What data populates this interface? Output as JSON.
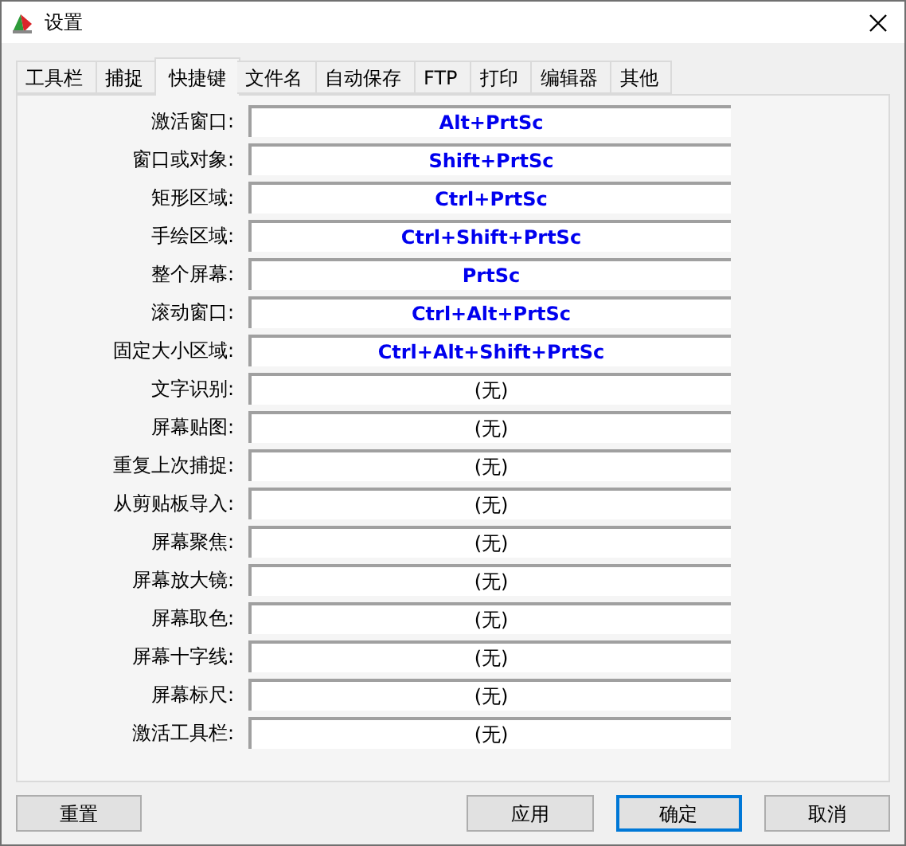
{
  "window": {
    "title": "设置"
  },
  "tabs": [
    {
      "label": "工具栏",
      "selected": false
    },
    {
      "label": "捕捉",
      "selected": false
    },
    {
      "label": "快捷键",
      "selected": true
    },
    {
      "label": "文件名",
      "selected": false
    },
    {
      "label": "自动保存",
      "selected": false
    },
    {
      "label": "FTP",
      "selected": false
    },
    {
      "label": "打印",
      "selected": false
    },
    {
      "label": "编辑器",
      "selected": false
    },
    {
      "label": "其他",
      "selected": false
    }
  ],
  "hotkeys": [
    {
      "label": "激活窗口:",
      "value": "Alt+PrtSc",
      "assigned": true
    },
    {
      "label": "窗口或对象:",
      "value": "Shift+PrtSc",
      "assigned": true
    },
    {
      "label": "矩形区域:",
      "value": "Ctrl+PrtSc",
      "assigned": true
    },
    {
      "label": "手绘区域:",
      "value": "Ctrl+Shift+PrtSc",
      "assigned": true
    },
    {
      "label": "整个屏幕:",
      "value": "PrtSc",
      "assigned": true
    },
    {
      "label": "滚动窗口:",
      "value": "Ctrl+Alt+PrtSc",
      "assigned": true
    },
    {
      "label": "固定大小区域:",
      "value": "Ctrl+Alt+Shift+PrtSc",
      "assigned": true
    },
    {
      "label": "文字识别:",
      "value": "(无)",
      "assigned": false
    },
    {
      "label": "屏幕贴图:",
      "value": "(无)",
      "assigned": false
    },
    {
      "label": "重复上次捕捉:",
      "value": "(无)",
      "assigned": false
    },
    {
      "label": "从剪贴板导入:",
      "value": "(无)",
      "assigned": false
    },
    {
      "label": "屏幕聚焦:",
      "value": "(无)",
      "assigned": false
    },
    {
      "label": "屏幕放大镜:",
      "value": "(无)",
      "assigned": false
    },
    {
      "label": "屏幕取色:",
      "value": "(无)",
      "assigned": false
    },
    {
      "label": "屏幕十字线:",
      "value": "(无)",
      "assigned": false
    },
    {
      "label": "屏幕标尺:",
      "value": "(无)",
      "assigned": false
    },
    {
      "label": "激活工具栏:",
      "value": "(无)",
      "assigned": false
    }
  ],
  "buttons": [
    {
      "label": "重置",
      "default": false
    },
    {
      "label": "应用",
      "default": false
    },
    {
      "label": "确定",
      "default": true
    },
    {
      "label": "取消",
      "default": false
    }
  ]
}
